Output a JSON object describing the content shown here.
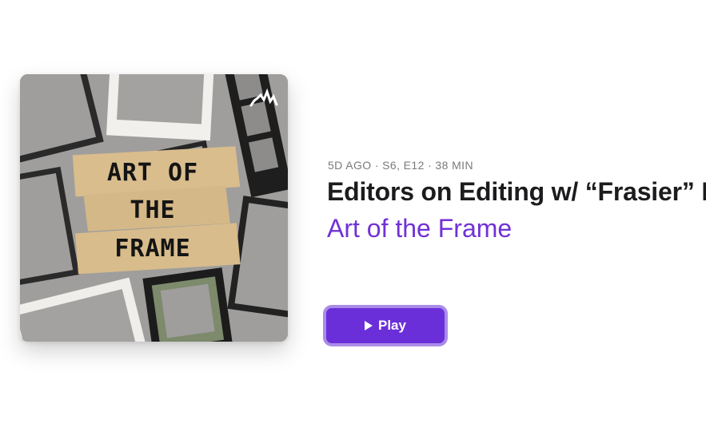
{
  "episode": {
    "meta": "5D AGO · S6, E12 · 38 MIN",
    "title": "Editors on Editing w/ “Frasier” Editor",
    "show": "Art of the Frame"
  },
  "artwork": {
    "tape_line1": "ART OF",
    "tape_line2": "THE",
    "tape_line3": "FRAME",
    "logo_icon": "anchor-waveform-icon"
  },
  "player": {
    "play_label": "Play",
    "play_icon": "play-icon"
  },
  "colors": {
    "accent": "#7131d6",
    "button_fill": "#6a2fd8",
    "button_ring": "#a98ce8",
    "meta_text": "#7a7a7a",
    "title_text": "#1c1c1e"
  }
}
